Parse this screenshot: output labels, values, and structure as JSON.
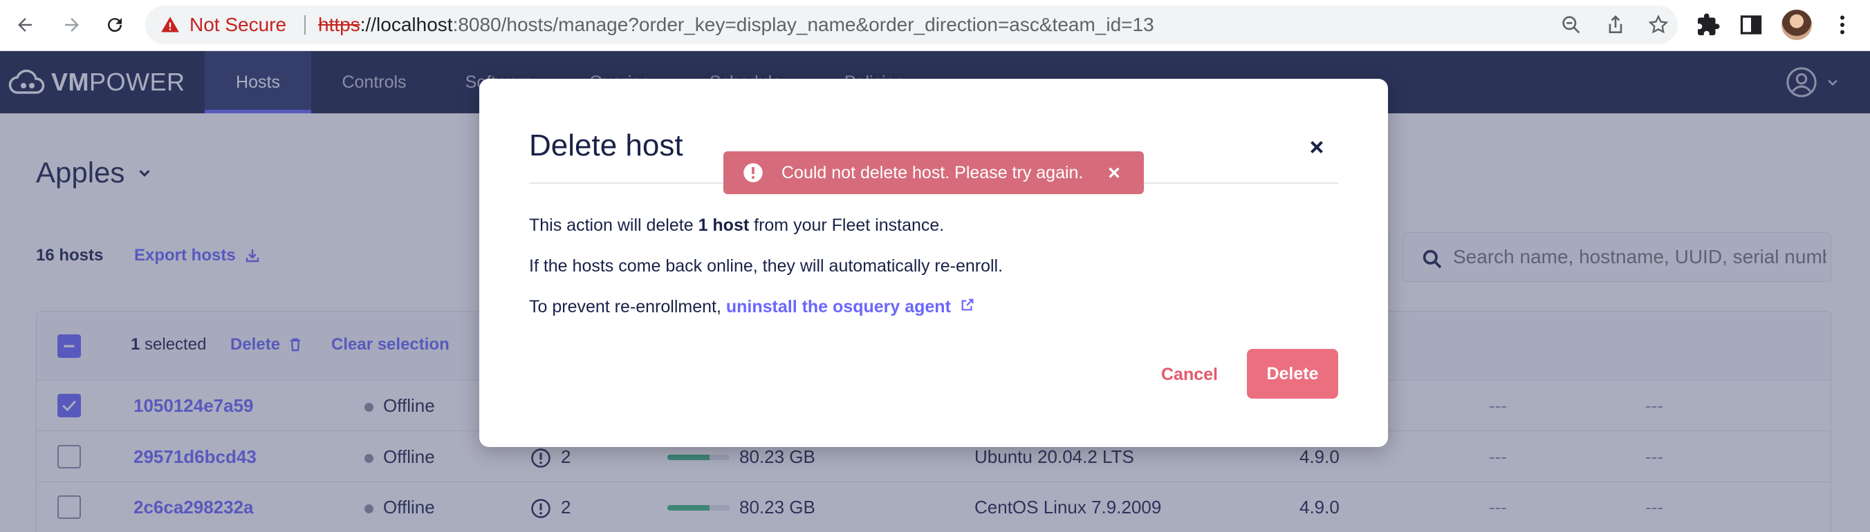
{
  "browser": {
    "security_label": "Not Secure",
    "url_scheme": "https",
    "url_host": "://localhost",
    "url_rest": ":8080/hosts/manage?order_key=display_name&order_direction=asc&team_id=13"
  },
  "app": {
    "logo_bold": "VM",
    "logo_light": "POWER",
    "nav": [
      {
        "label": "Hosts"
      },
      {
        "label": "Controls"
      },
      {
        "label": "Software"
      },
      {
        "label": "Queries"
      },
      {
        "label": "Schedule"
      },
      {
        "label": "Policies"
      }
    ]
  },
  "page": {
    "team_name": "Apples",
    "host_count": "16 hosts",
    "export_label": "Export hosts",
    "search_placeholder": "Search name, hostname, UUID, serial number, or IP address"
  },
  "table": {
    "selected_count": "1",
    "selected_suffix": "selected",
    "delete_label": "Delete",
    "clear_label": "Clear selection",
    "rows": [
      {
        "name": "1050124e7a59",
        "status": "Offline",
        "issues": "",
        "disk": "",
        "os": "",
        "osquery": "",
        "col7": "---",
        "col8": "---",
        "checked": true
      },
      {
        "name": "29571d6bcd43",
        "status": "Offline",
        "issues": "2",
        "disk": "80.23 GB",
        "disk_fill": 0.68,
        "os": "Ubuntu 20.04.2 LTS",
        "osquery": "4.9.0",
        "col7": "---",
        "col8": "---",
        "checked": false
      },
      {
        "name": "2c6ca298232a",
        "status": "Offline",
        "issues": "2",
        "disk": "80.23 GB",
        "disk_fill": 0.68,
        "os": "CentOS Linux 7.9.2009",
        "osquery": "4.9.0",
        "col7": "---",
        "col8": "---",
        "checked": false
      }
    ]
  },
  "modal": {
    "title": "Delete host",
    "line1_pre": "This action will delete ",
    "line1_bold": "1 host",
    "line1_post": " from your Fleet instance.",
    "line2": "If the hosts come back online, they will automatically re-enroll.",
    "line3_pre": "To prevent re-enrollment, ",
    "line3_link": "uninstall the osquery agent",
    "cancel_label": "Cancel",
    "delete_label": "Delete"
  },
  "flash": {
    "message": "Could not delete host. Please try again."
  },
  "colors": {
    "nav_bg": "#192147",
    "accent": "#6a67fe",
    "danger": "#ec6f80",
    "flash_bg": "#d66c7b"
  }
}
